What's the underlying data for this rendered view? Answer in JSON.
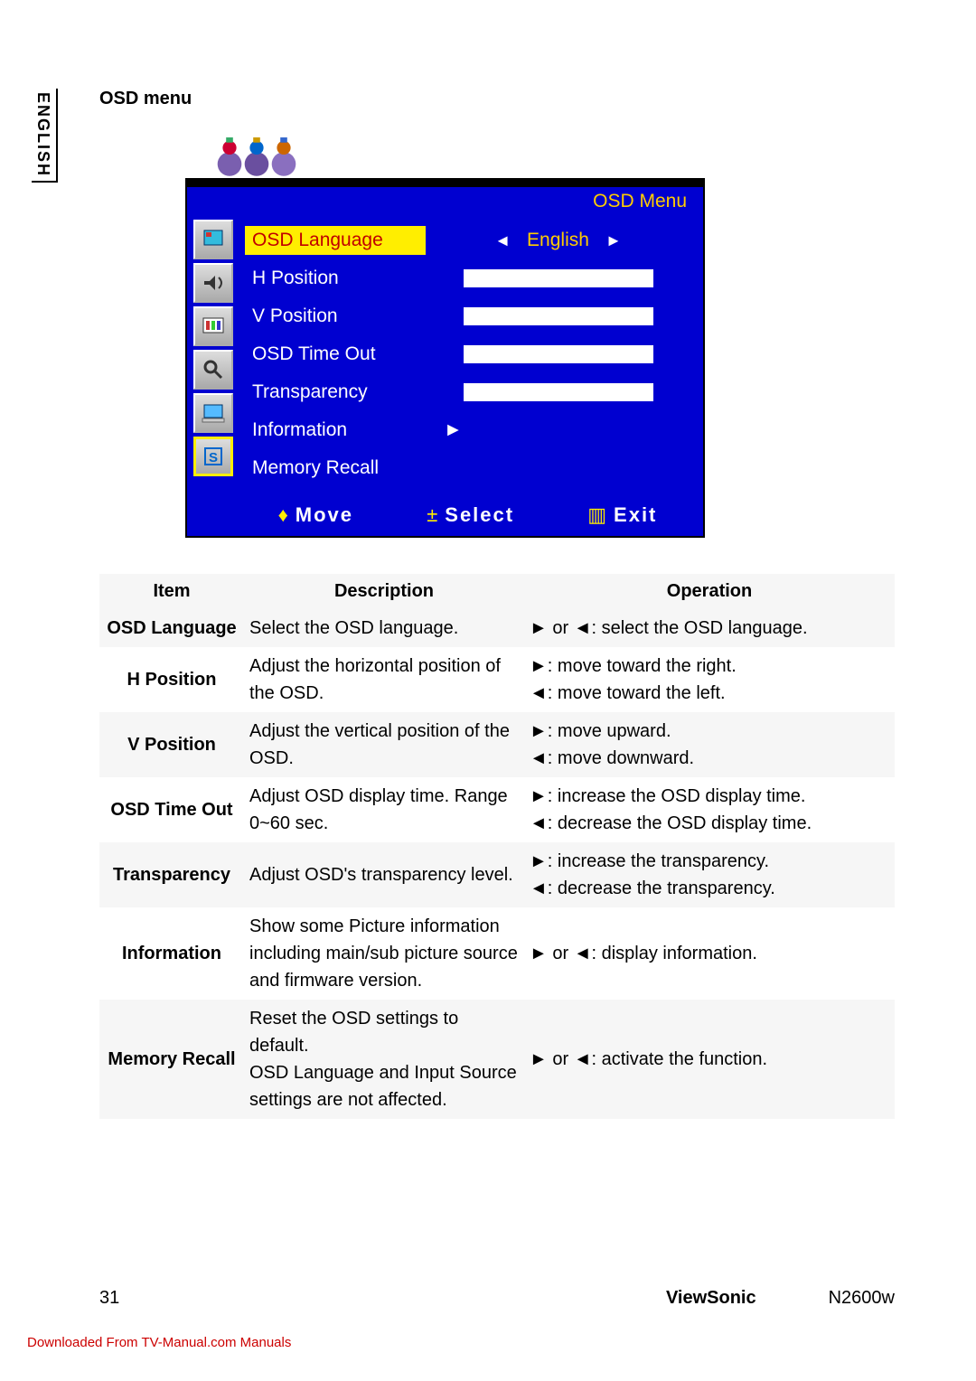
{
  "language_tab": "ENGLISH",
  "section_title": "OSD menu",
  "osd": {
    "title": "OSD Menu",
    "rows": [
      {
        "label": "OSD Language",
        "value": "English",
        "type": "select",
        "selected": true
      },
      {
        "label": "H Position",
        "type": "bar"
      },
      {
        "label": "V Position",
        "type": "bar"
      },
      {
        "label": "OSD Time Out",
        "type": "bar"
      },
      {
        "label": "Transparency",
        "type": "bar"
      },
      {
        "label": "Information",
        "type": "arrow"
      },
      {
        "label": "Memory Recall",
        "type": "none"
      }
    ],
    "footer": {
      "move": "Move",
      "select": "Select",
      "exit": "Exit"
    }
  },
  "table": {
    "headers": {
      "item": "Item",
      "description": "Description",
      "operation": "Operation"
    },
    "rows": [
      {
        "item": "OSD Language",
        "desc": "Select the OSD language.",
        "op": "► or ◄: select the OSD language."
      },
      {
        "item": "H Position",
        "desc": "Adjust the horizontal position of the OSD.",
        "op": "►: move toward the right.\n◄: move toward the left."
      },
      {
        "item": "V Position",
        "desc": "Adjust the vertical position of the OSD.",
        "op": "►: move upward.\n◄: move downward."
      },
      {
        "item": "OSD Time Out",
        "desc": "Adjust OSD display time. Range 0~60 sec.",
        "op": "►: increase the OSD display time.\n◄: decrease the OSD display time."
      },
      {
        "item": "Transparency",
        "desc": "Adjust OSD's transparency level.",
        "op": "►: increase the transparency.\n◄: decrease the transparency."
      },
      {
        "item": "Information",
        "desc": "Show some Picture information including main/sub picture source and firmware version.",
        "op": "► or ◄: display information."
      },
      {
        "item": "Memory Recall",
        "desc": "Reset the OSD settings to default.\nOSD Language and Input Source settings are not affected.",
        "op": "► or ◄: activate the function."
      }
    ]
  },
  "footer": {
    "page": "31",
    "brand": "ViewSonic",
    "model": "N2600w"
  },
  "download": "Downloaded From TV-Manual.com Manuals"
}
